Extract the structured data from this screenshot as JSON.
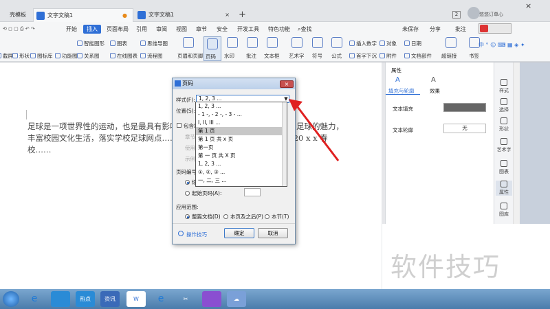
{
  "tabs": [
    {
      "label": "壳模板"
    },
    {
      "label": "文字文稿1"
    },
    {
      "label": "文字文稿1"
    }
  ],
  "window": {
    "badge": "2",
    "account": "悠悠订单心"
  },
  "menu": [
    "开始",
    "插入",
    "页面布局",
    "引用",
    "审阅",
    "视图",
    "章节",
    "安全",
    "开发工具",
    "特色功能"
  ],
  "menu_search": "查找",
  "menu_right": [
    "未保存",
    "分享",
    "批注"
  ],
  "ribbon": {
    "row1": [
      "智能图形",
      "图表",
      "页眉和页脚",
      "页码",
      "水印",
      "批注",
      "文本框",
      "艺术字",
      "符号",
      "公式",
      "插入数字",
      "对象",
      "日期",
      "超链接",
      "书签"
    ],
    "row2": [
      "截屏",
      "形状",
      "图标库",
      "功能图",
      "关系图",
      "在线图表",
      "流程图",
      "思维导图",
      "首字下沉",
      "附件",
      "文档部件"
    ],
    "left_row": [
      "截屏",
      "形状",
      "图标库",
      "功能图"
    ]
  },
  "document": {
    "text": "足球是一项世界性的运动，也是最具有影响力的运动之一，为了让同学感受到足球的魅力，丰富校园文化生活，落实学校足球网点……蓬勃开展。3 月 10 日中午，x x 20 x x 春校……"
  },
  "properties": {
    "title": "属性",
    "tabs": [
      "填充与轮廓",
      "效果"
    ],
    "text_fill": "文本填充",
    "text_outline": "文本轮廓",
    "outline_value": "无"
  },
  "sidebar": [
    "样式",
    "选择",
    "形状",
    "艺术字",
    "图表",
    "属性",
    "图库"
  ],
  "dialog": {
    "title": "页码",
    "style_label": "样式(F):",
    "style_value": "1, 2, 3 ...",
    "position_label": "位置(S):",
    "include_label": "包含章",
    "dim1": "章节",
    "dim2": "使用",
    "dim3": "示例",
    "numbering_label": "页码编号",
    "continue_label": "续",
    "start_label": "起始页码(A):",
    "scope_label": "应用范围:",
    "scope_options": [
      "整篇文档(D)",
      "本页及之后(P)",
      "本节(T)"
    ],
    "tips": "操作技巧",
    "ok": "确定",
    "cancel": "取消",
    "options": [
      "1, 2, 3 ...",
      "- 1 -, - 2 -, - 3 - ...",
      "I, II, III ...",
      "第 1 页",
      "第 1 页 共 x 页",
      "第一页",
      "第 一 页 共 X 页",
      "1, 2, 3 ...",
      "①, ②, ③ ...",
      "一, 二, 三 ..."
    ],
    "selected_index": 3
  },
  "taskbar": [
    "热点",
    "资讯"
  ],
  "watermark": "软件技巧",
  "colors": {
    "accent": "#2f6fd6",
    "arrow": "#e02020"
  }
}
